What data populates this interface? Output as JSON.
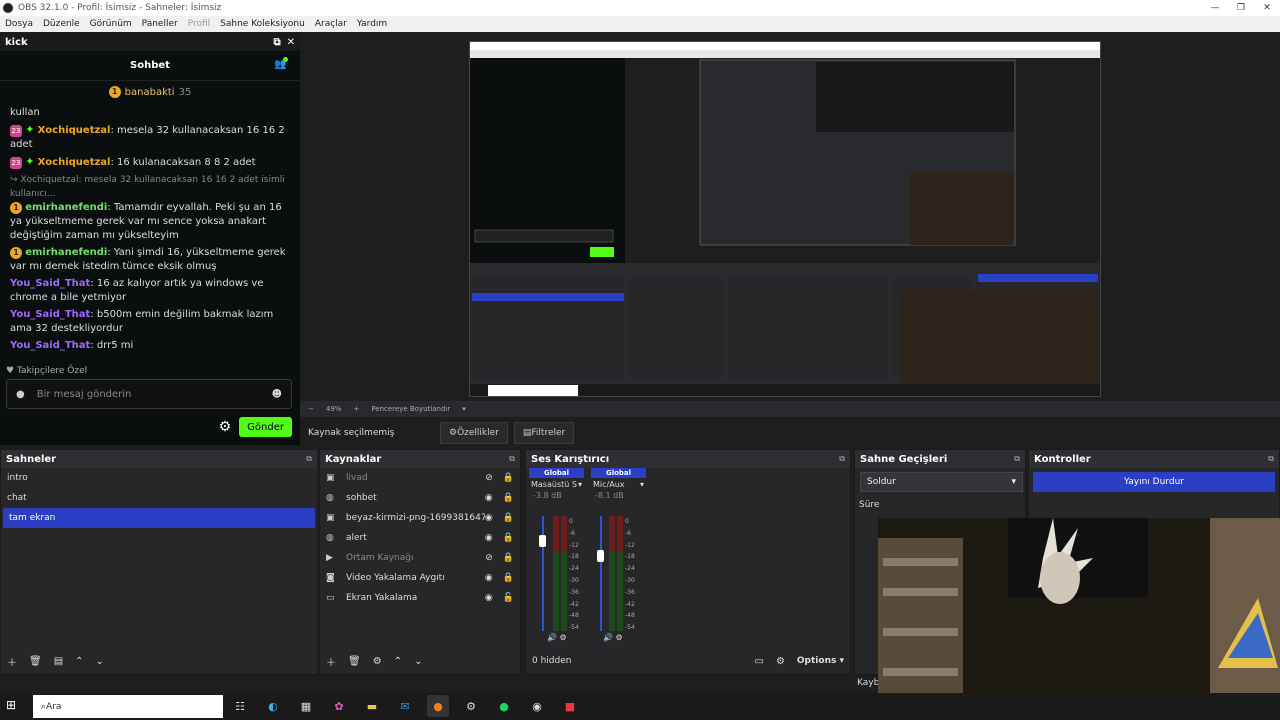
{
  "window": {
    "title": "OBS 32.1.0 - Profil: İsimsiz - Sahneler: İsimsiz"
  },
  "menu": [
    "Dosya",
    "Düzenle",
    "Görünüm",
    "Paneller",
    "Profil",
    "Sahne Koleksiyonu",
    "Araçlar",
    "Yardım"
  ],
  "kick": {
    "dock_title": "kick",
    "chat_title": "Sohbet",
    "pinned_user": "banabakti",
    "pinned_count": "35",
    "messages": [
      {
        "user": "",
        "text": "kullan"
      },
      {
        "badge": "23",
        "user": "Xochiquetzal",
        "text": ": mesela 32 kullanacaksan 16 16 2 adet"
      },
      {
        "badge": "23",
        "user": "Xochiquetzal",
        "text": ": 16 kulanacaksan 8 8 2 adet"
      },
      {
        "reply": "Xochiquetzal: mesela 32 kullanacaksan 16 16 2 adet isimli kullanıcı...",
        "user": "emirhanefendi",
        "text": ": Tamamdır eyvallah. Peki şu an 16 ya yükseltmeme gerek var mı sence yoksa anakart değiştiğim zaman mı yükselteyim"
      },
      {
        "user": "emirhanefendi",
        "text": ": Yani şimdi 16, yükseltmeme gerek var mı demek istedim tümce eksik olmuş"
      },
      {
        "user": "You_Said_That",
        "text": ": 16 az kalıyor artık ya windows ve chrome a bile yetmiyor"
      },
      {
        "user": "You_Said_That",
        "text": ": b500m emin değilim bakmak lazım ama 32 destekliyordur"
      },
      {
        "user": "You_Said_That",
        "text": ": drr5 mi"
      }
    ],
    "follow_label": "Takipçilere Özel",
    "input_placeholder": "Bir mesaj gönderin",
    "send_label": "Gönder"
  },
  "zoom": {
    "value": "49%",
    "mode": "Pencereye Boyutlandır"
  },
  "source_bar": {
    "label": "Kaynak seçilmemiş",
    "properties": "Özellikler",
    "filters": "Filtreler"
  },
  "scenes": {
    "title": "Sahneler",
    "items": [
      "intro",
      "chat",
      "tam ekran"
    ],
    "selected": 2
  },
  "sources": {
    "title": "Kaynaklar",
    "items": [
      {
        "name": "livad",
        "icon": "image-icon",
        "hidden": true,
        "locked": true
      },
      {
        "name": "sohbet",
        "icon": "browser-icon",
        "hidden": false,
        "locked": true
      },
      {
        "name": "beyaz-kirmizi-png-1699381647670.p",
        "icon": "image-icon",
        "hidden": false,
        "locked": true
      },
      {
        "name": "alert",
        "icon": "browser-icon",
        "hidden": false,
        "locked": true
      },
      {
        "name": "Ortam Kaynağı",
        "icon": "play-icon",
        "hidden": true,
        "locked": true
      },
      {
        "name": "Video Yakalama Aygıtı",
        "icon": "camera-icon",
        "hidden": false,
        "locked": true
      },
      {
        "name": "Ekran Yakalama",
        "icon": "monitor-icon",
        "hidden": false,
        "locked": false
      }
    ]
  },
  "mixer": {
    "title": "Ses Karıştırıcı",
    "channels": [
      {
        "group": "Global",
        "name": "Masaüstü Ses",
        "db": "-3.8 dB",
        "level": 0.78
      },
      {
        "group": "Global",
        "name": "Mic/Aux",
        "db": "-8.1 dB",
        "level": 0.65
      }
    ],
    "ticks": [
      "0",
      "-6",
      "-12",
      "-18",
      "-24",
      "-30",
      "-36",
      "-42",
      "-48",
      "-54",
      "-60"
    ],
    "hidden_label": "0 hidden",
    "options_label": "Options"
  },
  "transitions": {
    "title": "Sahne Geçişleri",
    "selected": "Soldur",
    "duration_label": "Süre",
    "bottom_label": "Kaybı"
  },
  "controls": {
    "title": "Kontroller",
    "stop_stream": "Yayını Durdur"
  },
  "taskbar": {
    "search_placeholder": "Ara"
  },
  "colors": {
    "accent": "#2b3fc4",
    "kick_green": "#53fc18",
    "background": "#1f1e1f"
  }
}
